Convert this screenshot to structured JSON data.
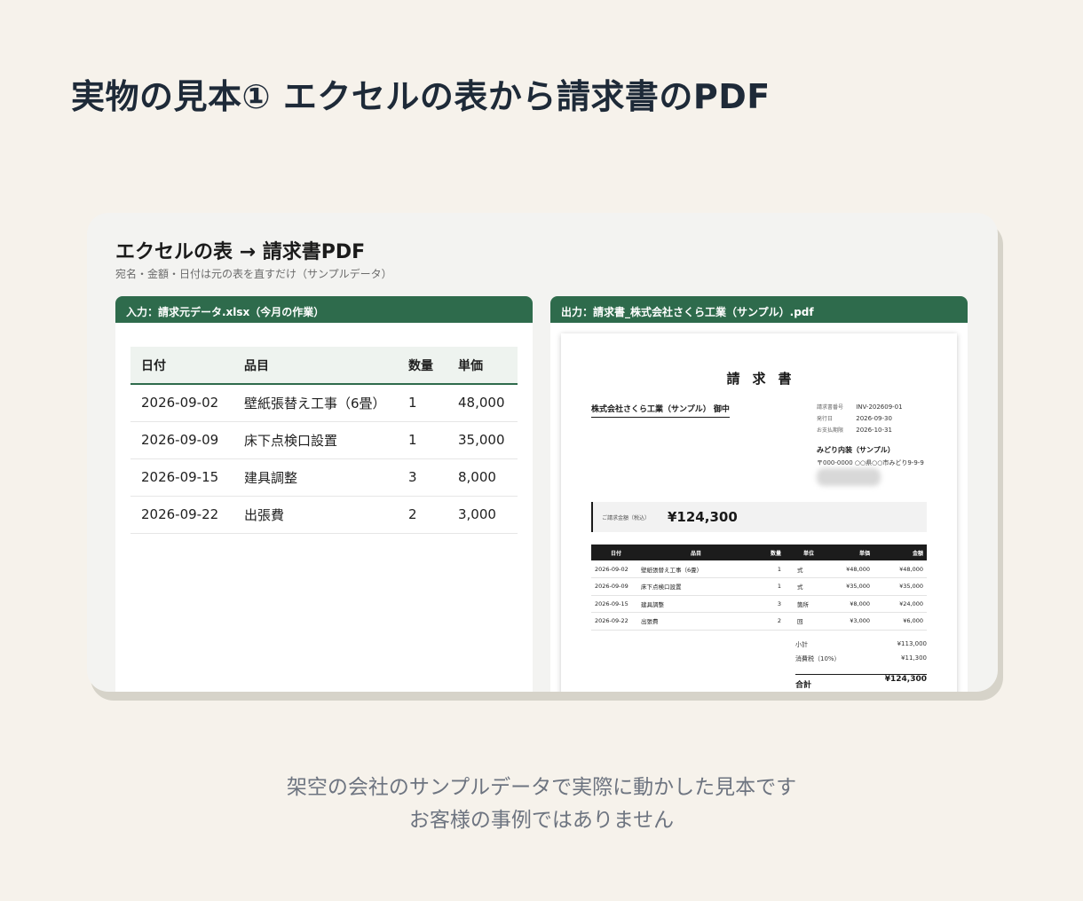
{
  "page": {
    "title": "実物の見本① エクセルの表から請求書のPDF",
    "footer_line1": "架空の会社のサンプルデータで実際に動かした見本です",
    "footer_line2": "お客様の事例ではありません"
  },
  "card": {
    "title": "エクセルの表 → 請求書PDF",
    "subtitle": "宛名・金額・日付は元の表を直すだけ（サンプルデータ）"
  },
  "input_panel": {
    "header": "入力：請求元データ.xlsx（今月の作業）",
    "columns": [
      "日付",
      "品目",
      "数量",
      "単価"
    ],
    "rows": [
      [
        "2026-09-02",
        "壁紙張替え工事（6畳）",
        "1",
        "48,000"
      ],
      [
        "2026-09-09",
        "床下点検口設置",
        "1",
        "35,000"
      ],
      [
        "2026-09-15",
        "建具調整",
        "3",
        "8,000"
      ],
      [
        "2026-09-22",
        "出張費",
        "2",
        "3,000"
      ]
    ]
  },
  "output_panel": {
    "header": "出力：請求書_株式会社さくら工業（サンプル）.pdf",
    "pdf": {
      "title": "請求書",
      "recipient": "株式会社さくら工業（サンプル） 御中",
      "meta": [
        {
          "label": "請求書番号",
          "value": "INV-202609-01"
        },
        {
          "label": "発行日",
          "value": "2026-09-30"
        },
        {
          "label": "お支払期限",
          "value": "2026-10-31"
        }
      ],
      "issuer_name": "みどり内装（サンプル）",
      "issuer_address": "〒000-0000 ○○県○○市みどり9-9-9",
      "total_label": "ご請求金額（税込）",
      "total_amount": "¥124,300",
      "columns": [
        "日付",
        "品目",
        "数量",
        "単位",
        "単価",
        "金額"
      ],
      "rows": [
        [
          "2026-09-02",
          "壁紙張替え工事（6畳）",
          "1",
          "式",
          "¥48,000",
          "¥48,000"
        ],
        [
          "2026-09-09",
          "床下点検口設置",
          "1",
          "式",
          "¥35,000",
          "¥35,000"
        ],
        [
          "2026-09-15",
          "建具調整",
          "3",
          "箇所",
          "¥8,000",
          "¥24,000"
        ],
        [
          "2026-09-22",
          "出張費",
          "2",
          "回",
          "¥3,000",
          "¥6,000"
        ]
      ],
      "subtotal_label": "小計",
      "subtotal_value": "¥113,000",
      "tax_label": "消費税（10%）",
      "tax_value": "¥11,300",
      "grand_label": "合計",
      "grand_value": "¥124,300"
    }
  },
  "colors": {
    "accent_green": "#2e6b4c",
    "background": "#f6f2eb"
  }
}
